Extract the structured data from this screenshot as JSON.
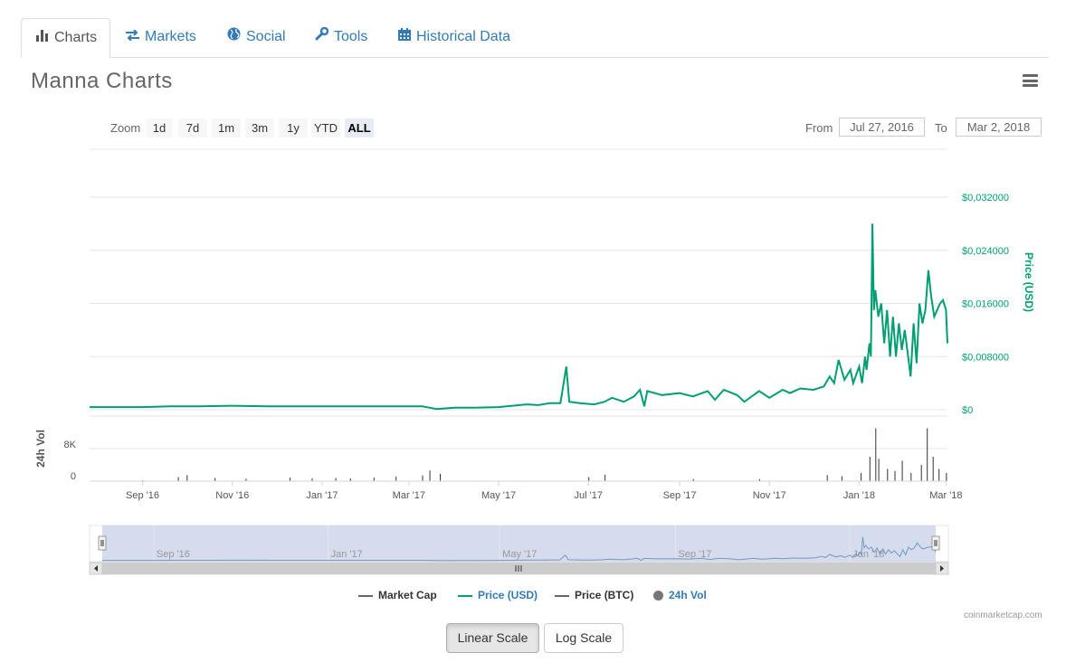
{
  "tabs": [
    {
      "label": "Charts",
      "icon": "bar-chart-icon",
      "active": true
    },
    {
      "label": "Markets",
      "icon": "exchange-icon",
      "active": false
    },
    {
      "label": "Social",
      "icon": "globe-icon",
      "active": false
    },
    {
      "label": "Tools",
      "icon": "wrench-icon",
      "active": false
    },
    {
      "label": "Historical Data",
      "icon": "calendar-icon",
      "active": false
    }
  ],
  "page_title": "Manna Charts",
  "zoom": {
    "label": "Zoom",
    "buttons": [
      "1d",
      "7d",
      "1m",
      "3m",
      "1y",
      "YTD",
      "ALL"
    ],
    "selected": "ALL"
  },
  "range": {
    "from_label": "From",
    "from_value": "Jul 27, 2016",
    "to_label": "To",
    "to_value": "Mar 2, 2018"
  },
  "credit": "coinmarketcap.com",
  "scale_buttons": {
    "linear": "Linear Scale",
    "log": "Log Scale",
    "selected": "linear"
  },
  "colors": {
    "price_usd": "#009e73",
    "volume": "#333333",
    "navigator_fill": "#ccd6eb",
    "accent_link": "#337ab7"
  },
  "chart_data": {
    "type": "line",
    "x_range": [
      "2016-07-27",
      "2018-03-02"
    ],
    "x_ticks": [
      "Sep '16",
      "Nov '16",
      "Jan '17",
      "Mar '17",
      "May '17",
      "Jul '17",
      "Sep '17",
      "Nov '17",
      "Jan '18",
      "Mar '18"
    ],
    "y_axis_right": {
      "label": "Price (USD)",
      "ticks": [
        "$0",
        "$0,008000",
        "$0,016000",
        "$0,024000",
        "$0,032000"
      ],
      "range": [
        0,
        0.032
      ]
    },
    "volume_axis": {
      "label": "24h Vol",
      "ticks": [
        "0",
        "8K"
      ]
    },
    "navigator_ticks": [
      "Sep '16",
      "Jan '17",
      "May '17",
      "Sep '17",
      "Jan '18"
    ],
    "legend": [
      {
        "name": "Market Cap",
        "type": "line",
        "color": "#666666",
        "active": false
      },
      {
        "name": "Price (USD)",
        "type": "line",
        "color": "#009e73",
        "active": true
      },
      {
        "name": "Price (BTC)",
        "type": "line",
        "color": "#666666",
        "active": false
      },
      {
        "name": "24h Vol",
        "type": "circle",
        "color": "#777777",
        "active": true
      }
    ],
    "series": [
      {
        "name": "Price (USD)",
        "points": [
          [
            "2016-07-27",
            0.0004
          ],
          [
            "2016-08-15",
            0.0004
          ],
          [
            "2016-09-01",
            0.0004
          ],
          [
            "2016-09-20",
            0.0005
          ],
          [
            "2016-10-10",
            0.0005
          ],
          [
            "2016-11-01",
            0.0006
          ],
          [
            "2016-11-25",
            0.0005
          ],
          [
            "2016-12-15",
            0.0005
          ],
          [
            "2017-01-05",
            0.0005
          ],
          [
            "2017-01-25",
            0.0005
          ],
          [
            "2017-02-15",
            0.0005
          ],
          [
            "2017-03-10",
            0.0005
          ],
          [
            "2017-03-20",
            0.0001
          ],
          [
            "2017-04-01",
            0.0003
          ],
          [
            "2017-04-15",
            0.0003
          ],
          [
            "2017-05-01",
            0.0004
          ],
          [
            "2017-05-20",
            0.0008
          ],
          [
            "2017-05-28",
            0.0007
          ],
          [
            "2017-06-05",
            0.001
          ],
          [
            "2017-06-12",
            0.001
          ],
          [
            "2017-06-16",
            0.0065
          ],
          [
            "2017-06-18",
            0.0012
          ],
          [
            "2017-06-25",
            0.001
          ],
          [
            "2017-07-05",
            0.0008
          ],
          [
            "2017-07-12",
            0.0012
          ],
          [
            "2017-07-17",
            0.0018
          ],
          [
            "2017-07-25",
            0.0012
          ],
          [
            "2017-08-01",
            0.002
          ],
          [
            "2017-08-05",
            0.003
          ],
          [
            "2017-08-08",
            0.0005
          ],
          [
            "2017-08-10",
            0.0028
          ],
          [
            "2017-08-20",
            0.0022
          ],
          [
            "2017-09-01",
            0.0025
          ],
          [
            "2017-09-10",
            0.002
          ],
          [
            "2017-09-20",
            0.0028
          ],
          [
            "2017-09-25",
            0.0015
          ],
          [
            "2017-10-01",
            0.003
          ],
          [
            "2017-10-10",
            0.0022
          ],
          [
            "2017-10-15",
            0.0012
          ],
          [
            "2017-10-20",
            0.002
          ],
          [
            "2017-10-25",
            0.0028
          ],
          [
            "2017-11-01",
            0.0018
          ],
          [
            "2017-11-10",
            0.003
          ],
          [
            "2017-11-15",
            0.0025
          ],
          [
            "2017-11-22",
            0.0032
          ],
          [
            "2017-12-01",
            0.003
          ],
          [
            "2017-12-08",
            0.0035
          ],
          [
            "2017-12-12",
            0.005
          ],
          [
            "2017-12-15",
            0.004
          ],
          [
            "2017-12-18",
            0.0075
          ],
          [
            "2017-12-22",
            0.0045
          ],
          [
            "2017-12-26",
            0.006
          ],
          [
            "2017-12-28",
            0.004
          ],
          [
            "2018-01-01",
            0.0065
          ],
          [
            "2018-01-03",
            0.004
          ],
          [
            "2018-01-05",
            0.008
          ],
          [
            "2018-01-06",
            0.006
          ],
          [
            "2018-01-08",
            0.01
          ],
          [
            "2018-01-09",
            0.008
          ],
          [
            "2018-01-10",
            0.028
          ],
          [
            "2018-01-11",
            0.015
          ],
          [
            "2018-01-12",
            0.018
          ],
          [
            "2018-01-14",
            0.014
          ],
          [
            "2018-01-16",
            0.016
          ],
          [
            "2018-01-18",
            0.01
          ],
          [
            "2018-01-20",
            0.015
          ],
          [
            "2018-01-22",
            0.008
          ],
          [
            "2018-01-24",
            0.014
          ],
          [
            "2018-01-26",
            0.008
          ],
          [
            "2018-01-28",
            0.013
          ],
          [
            "2018-01-30",
            0.009
          ],
          [
            "2018-02-01",
            0.012
          ],
          [
            "2018-02-03",
            0.0085
          ],
          [
            "2018-02-05",
            0.005
          ],
          [
            "2018-02-07",
            0.013
          ],
          [
            "2018-02-09",
            0.007
          ],
          [
            "2018-02-11",
            0.016
          ],
          [
            "2018-02-13",
            0.013
          ],
          [
            "2018-02-15",
            0.015
          ],
          [
            "2018-02-17",
            0.021
          ],
          [
            "2018-02-19",
            0.017
          ],
          [
            "2018-02-21",
            0.014
          ],
          [
            "2018-02-23",
            0.015
          ],
          [
            "2018-02-25",
            0.016
          ],
          [
            "2018-02-27",
            0.0165
          ],
          [
            "2018-03-01",
            0.015
          ],
          [
            "2018-03-02",
            0.01
          ]
        ]
      },
      {
        "name": "24h Vol",
        "points": [
          [
            "2016-09-01",
            200
          ],
          [
            "2016-09-25",
            1000
          ],
          [
            "2016-10-01",
            1500
          ],
          [
            "2016-10-20",
            800
          ],
          [
            "2016-11-10",
            600
          ],
          [
            "2016-12-10",
            900
          ],
          [
            "2016-12-25",
            700
          ],
          [
            "2017-01-10",
            800
          ],
          [
            "2017-01-20",
            700
          ],
          [
            "2017-02-05",
            900
          ],
          [
            "2017-02-20",
            1100
          ],
          [
            "2017-03-10",
            1400
          ],
          [
            "2017-03-15",
            2600
          ],
          [
            "2017-03-22",
            1800
          ],
          [
            "2017-07-01",
            1000
          ],
          [
            "2017-07-12",
            1600
          ],
          [
            "2017-09-10",
            500
          ],
          [
            "2017-10-25",
            500
          ],
          [
            "2017-12-10",
            1500
          ],
          [
            "2017-12-20",
            1200
          ],
          [
            "2018-01-02",
            2000
          ],
          [
            "2018-01-08",
            6000
          ],
          [
            "2018-01-12",
            13000
          ],
          [
            "2018-01-14",
            5500
          ],
          [
            "2018-01-20",
            3000
          ],
          [
            "2018-01-25",
            2500
          ],
          [
            "2018-01-30",
            5000
          ],
          [
            "2018-02-05",
            2000
          ],
          [
            "2018-02-12",
            4000
          ],
          [
            "2018-02-16",
            13000
          ],
          [
            "2018-02-20",
            6000
          ],
          [
            "2018-02-24",
            3000
          ],
          [
            "2018-03-01",
            2000
          ]
        ]
      }
    ]
  }
}
